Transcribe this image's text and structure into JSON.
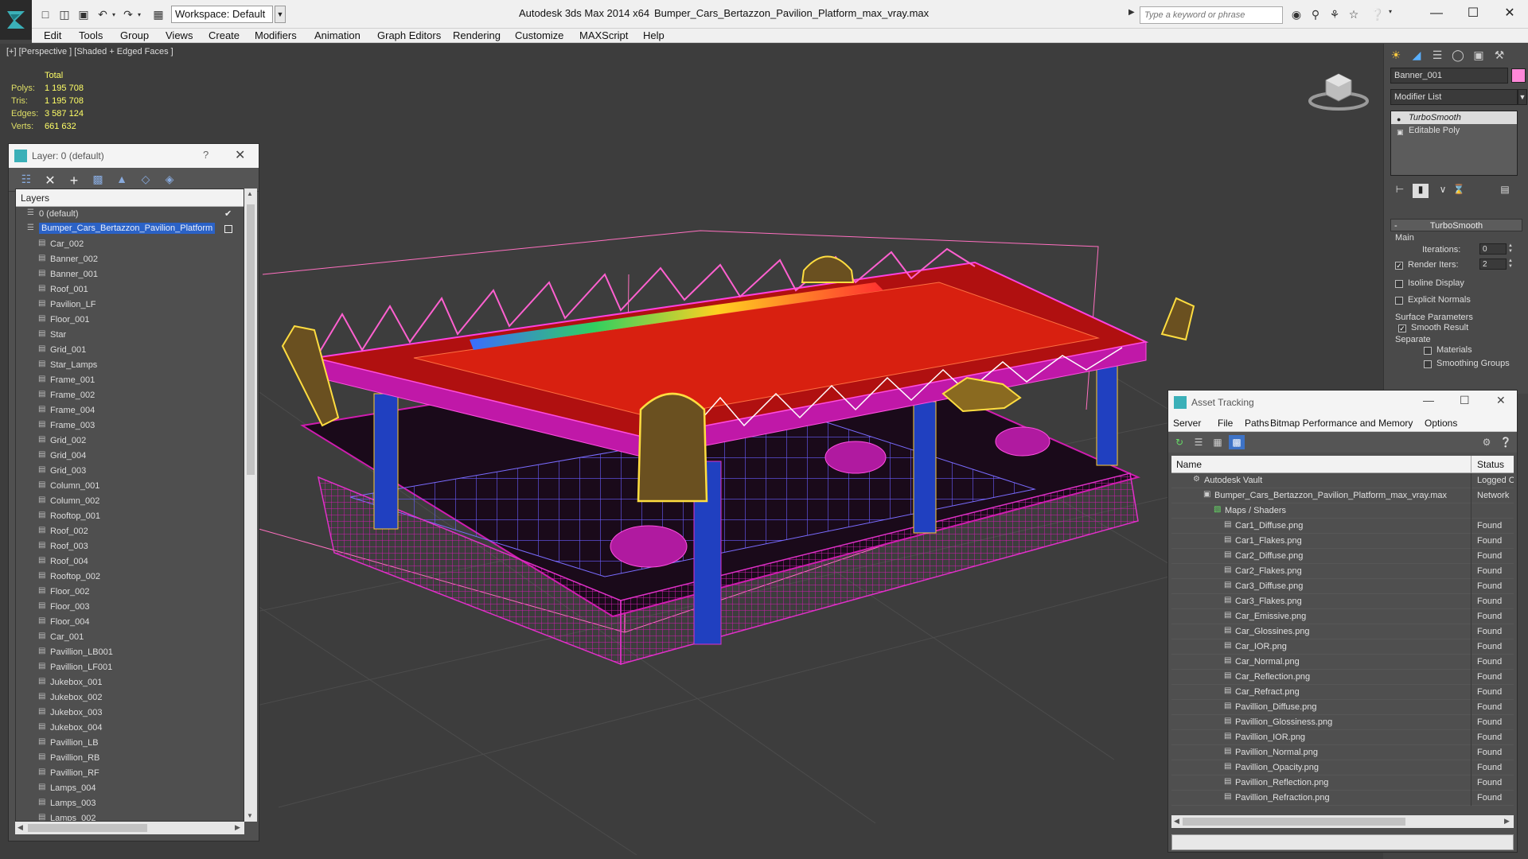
{
  "titlebar": {
    "workspace": "Workspace: Default",
    "app_title": "Autodesk 3ds Max  2014 x64",
    "file_title": "Bumper_Cars_Bertazzon_Pavilion_Platform_max_vray.max",
    "search_placeholder": "Type a keyword or phrase"
  },
  "menu": [
    "Edit",
    "Tools",
    "Group",
    "Views",
    "Create",
    "Modifiers",
    "Animation",
    "Graph Editors",
    "Rendering",
    "Customize",
    "MAXScript",
    "Help"
  ],
  "viewport": {
    "label": "[+] [Perspective ] [Shaded + Edged Faces ]",
    "stats_header": "Total",
    "stats": [
      {
        "label": "Polys:",
        "value": "1 195 708"
      },
      {
        "label": "Tris:",
        "value": "1 195 708"
      },
      {
        "label": "Edges:",
        "value": "3 587 124"
      },
      {
        "label": "Verts:",
        "value": "661 632"
      }
    ]
  },
  "layer_explorer": {
    "title": "Layer: 0 (default)",
    "help": "?",
    "header": "Layers",
    "rows": [
      {
        "name": "0 (default)",
        "level": 1,
        "mark": "check"
      },
      {
        "name": "Bumper_Cars_Bertazzon_Pavilion_Platform",
        "level": 1,
        "mark": "box",
        "selected": true
      },
      {
        "name": "Car_002",
        "level": 2
      },
      {
        "name": "Banner_002",
        "level": 2
      },
      {
        "name": "Banner_001",
        "level": 2
      },
      {
        "name": "Roof_001",
        "level": 2
      },
      {
        "name": "Pavilion_LF",
        "level": 2
      },
      {
        "name": "Floor_001",
        "level": 2
      },
      {
        "name": "Star",
        "level": 2
      },
      {
        "name": "Grid_001",
        "level": 2
      },
      {
        "name": "Star_Lamps",
        "level": 2
      },
      {
        "name": "Frame_001",
        "level": 2
      },
      {
        "name": "Frame_002",
        "level": 2
      },
      {
        "name": "Frame_004",
        "level": 2
      },
      {
        "name": "Frame_003",
        "level": 2
      },
      {
        "name": "Grid_002",
        "level": 2
      },
      {
        "name": "Grid_004",
        "level": 2
      },
      {
        "name": "Grid_003",
        "level": 2
      },
      {
        "name": "Column_001",
        "level": 2
      },
      {
        "name": "Column_002",
        "level": 2
      },
      {
        "name": "Rooftop_001",
        "level": 2
      },
      {
        "name": "Roof_002",
        "level": 2
      },
      {
        "name": "Roof_003",
        "level": 2
      },
      {
        "name": "Roof_004",
        "level": 2
      },
      {
        "name": "Rooftop_002",
        "level": 2
      },
      {
        "name": "Floor_002",
        "level": 2
      },
      {
        "name": "Floor_003",
        "level": 2
      },
      {
        "name": "Floor_004",
        "level": 2
      },
      {
        "name": "Car_001",
        "level": 2
      },
      {
        "name": "Pavillion_LB001",
        "level": 2
      },
      {
        "name": "Pavillion_LF001",
        "level": 2
      },
      {
        "name": "Jukebox_001",
        "level": 2
      },
      {
        "name": "Jukebox_002",
        "level": 2
      },
      {
        "name": "Jukebox_003",
        "level": 2
      },
      {
        "name": "Jukebox_004",
        "level": 2
      },
      {
        "name": "Pavillion_LB",
        "level": 2
      },
      {
        "name": "Pavillion_RB",
        "level": 2
      },
      {
        "name": "Pavillion_RF",
        "level": 2
      },
      {
        "name": "Lamps_004",
        "level": 2
      },
      {
        "name": "Lamps_003",
        "level": 2
      },
      {
        "name": "Lamps_002",
        "level": 2
      }
    ]
  },
  "command_panel": {
    "object_name": "Banner_001",
    "object_color": "#ff88d8",
    "modifier_list": "Modifier List",
    "stack": [
      {
        "name": "TurboSmooth",
        "active": true
      },
      {
        "name": "Editable Poly",
        "active": false
      }
    ],
    "turbosmooth": {
      "title": "TurboSmooth",
      "main": "Main",
      "iterations_label": "Iterations:",
      "iterations": "0",
      "render_iters_label": "Render Iters:",
      "render_iters": "2",
      "isoline": "Isoline Display",
      "explicit": "Explicit Normals",
      "surface": "Surface Parameters",
      "smooth": "Smooth Result",
      "separate": "Separate",
      "materials": "Materials",
      "smoothing": "Smoothing Groups"
    }
  },
  "asset_tracking": {
    "title": "Asset Tracking",
    "menu": [
      "Server",
      "File",
      "Paths",
      "Bitmap Performance and Memory",
      "Options"
    ],
    "col_name": "Name",
    "col_status": "Status",
    "rows": [
      {
        "name": "Autodesk Vault",
        "status": "Logged Out",
        "indent": 1,
        "icon": "vault"
      },
      {
        "name": "Bumper_Cars_Bertazzon_Pavilion_Platform_max_vray.max",
        "status": "Network",
        "indent": 2,
        "icon": "max"
      },
      {
        "name": "Maps / Shaders",
        "status": "",
        "indent": 3,
        "icon": "maps"
      },
      {
        "name": "Car1_Diffuse.png",
        "status": "Found",
        "indent": 4,
        "icon": "file"
      },
      {
        "name": "Car1_Flakes.png",
        "status": "Found",
        "indent": 4,
        "icon": "file"
      },
      {
        "name": "Car2_Diffuse.png",
        "status": "Found",
        "indent": 4,
        "icon": "file"
      },
      {
        "name": "Car2_Flakes.png",
        "status": "Found",
        "indent": 4,
        "icon": "file"
      },
      {
        "name": "Car3_Diffuse.png",
        "status": "Found",
        "indent": 4,
        "icon": "file"
      },
      {
        "name": "Car3_Flakes.png",
        "status": "Found",
        "indent": 4,
        "icon": "file"
      },
      {
        "name": "Car_Emissive.png",
        "status": "Found",
        "indent": 4,
        "icon": "file"
      },
      {
        "name": "Car_Glossines.png",
        "status": "Found",
        "indent": 4,
        "icon": "file"
      },
      {
        "name": "Car_IOR.png",
        "status": "Found",
        "indent": 4,
        "icon": "file"
      },
      {
        "name": "Car_Normal.png",
        "status": "Found",
        "indent": 4,
        "icon": "file"
      },
      {
        "name": "Car_Reflection.png",
        "status": "Found",
        "indent": 4,
        "icon": "file"
      },
      {
        "name": "Car_Refract.png",
        "status": "Found",
        "indent": 4,
        "icon": "file"
      },
      {
        "name": "Pavillion_Diffuse.png",
        "status": "Found",
        "indent": 4,
        "icon": "file"
      },
      {
        "name": "Pavillion_Glossiness.png",
        "status": "Found",
        "indent": 4,
        "icon": "file"
      },
      {
        "name": "Pavillion_IOR.png",
        "status": "Found",
        "indent": 4,
        "icon": "file"
      },
      {
        "name": "Pavillion_Normal.png",
        "status": "Found",
        "indent": 4,
        "icon": "file"
      },
      {
        "name": "Pavillion_Opacity.png",
        "status": "Found",
        "indent": 4,
        "icon": "file"
      },
      {
        "name": "Pavillion_Reflection.png",
        "status": "Found",
        "indent": 4,
        "icon": "file"
      },
      {
        "name": "Pavillion_Refraction.png",
        "status": "Found",
        "indent": 4,
        "icon": "file"
      }
    ]
  }
}
